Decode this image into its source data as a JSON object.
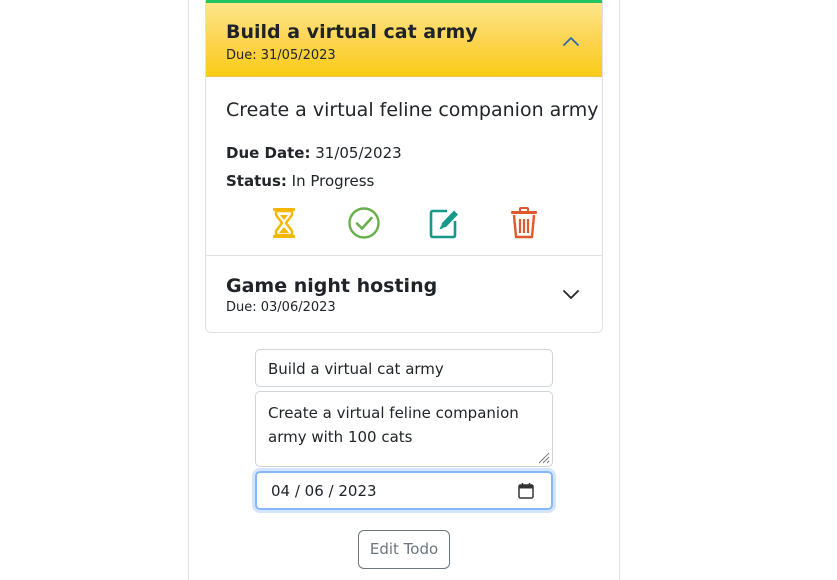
{
  "todos": [
    {
      "title": "Build a virtual cat army",
      "due_line": "Due: 31/05/2023",
      "expanded": true,
      "description": "Create a virtual feline companion army",
      "due_label": "Due Date:",
      "due_value": "31/05/2023",
      "status_label": "Status:",
      "status_value": "In Progress"
    },
    {
      "title": "Game night hosting",
      "due_line": "Due: 03/06/2023",
      "expanded": false
    }
  ],
  "actions": [
    {
      "name": "hourglass-icon",
      "color": "#f5b800"
    },
    {
      "name": "check-circle-icon",
      "color": "#6ab04c"
    },
    {
      "name": "edit-icon",
      "color": "#17998a"
    },
    {
      "name": "trash-icon",
      "color": "#e0592a"
    }
  ],
  "form": {
    "title_value": "Build a virtual cat army",
    "description_value": "Create a virtual feline companion army with 100 cats",
    "date_value": "04 / 06 / 2023",
    "submit_label": "Edit Todo"
  },
  "colors": {
    "accent_header": "#fcd34d",
    "header_top_border": "#22c55e",
    "focus_ring": "#86b7fe"
  }
}
